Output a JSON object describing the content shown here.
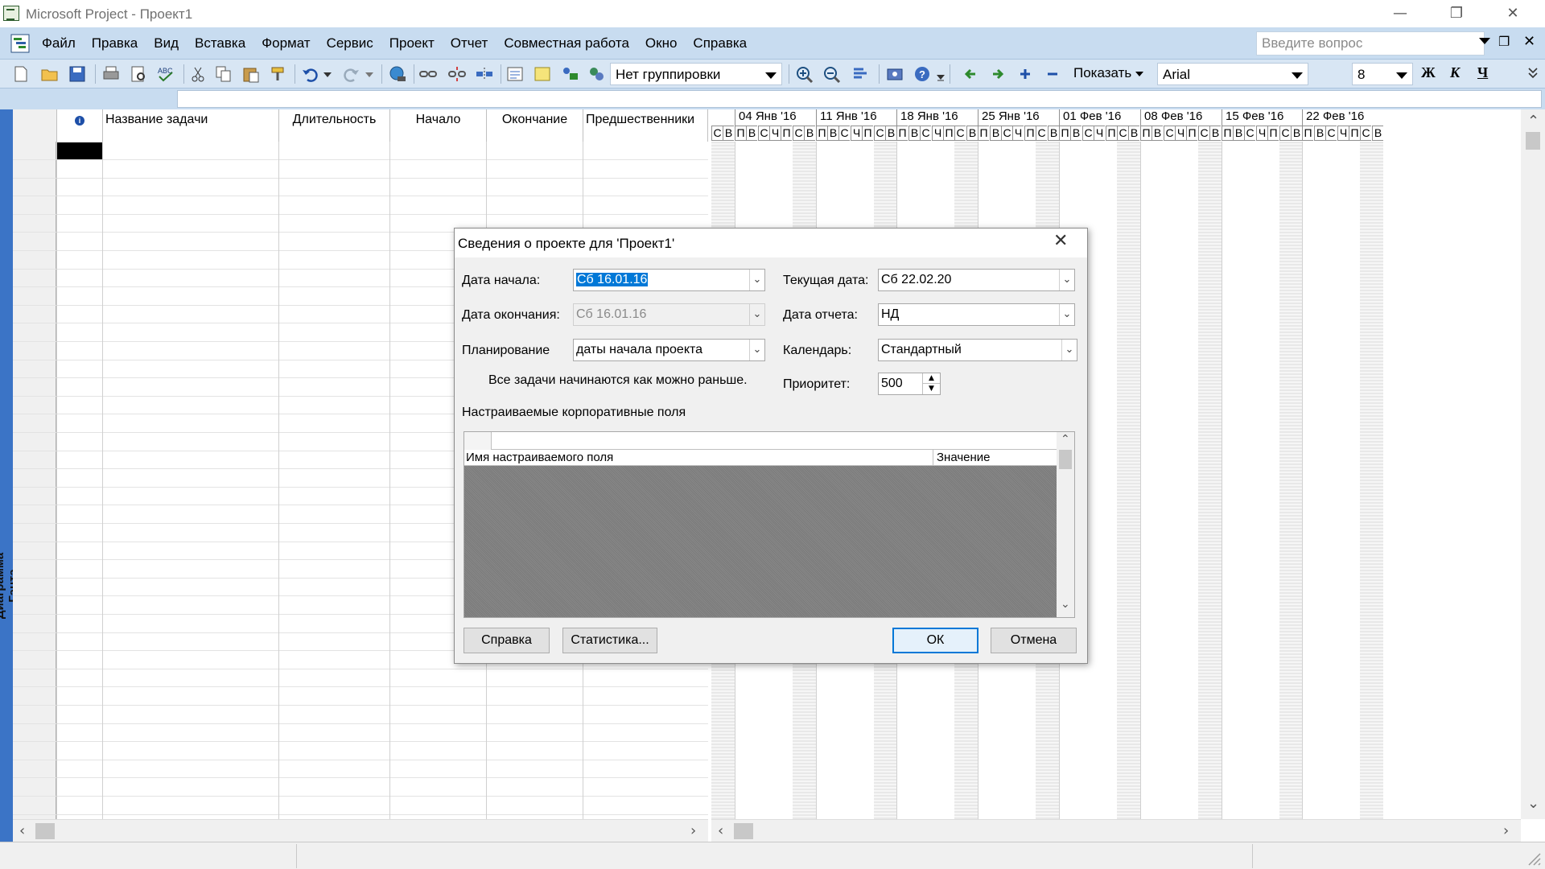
{
  "window": {
    "title": "Microsoft Project - Проект1"
  },
  "menu": {
    "items": [
      "Файл",
      "Правка",
      "Вид",
      "Вставка",
      "Формат",
      "Сервис",
      "Проект",
      "Отчет",
      "Совместная работа",
      "Окно",
      "Справка"
    ],
    "help_placeholder": "Введите вопрос"
  },
  "toolbar": {
    "grouping": "Нет группировки",
    "show_label": "Показать",
    "font": "Arial",
    "font_size": "8",
    "bold": "Ж",
    "italic": "К",
    "underline": "Ч"
  },
  "viewbar": {
    "label": "Диаграмма Ганта"
  },
  "table": {
    "info_icon": "i",
    "columns": [
      "Название задачи",
      "Длительность",
      "Начало",
      "Окончание",
      "Предшественники"
    ]
  },
  "gantt": {
    "weeks": [
      "04 Янв '16",
      "11 Янв '16",
      "18 Янв '16",
      "25 Янв '16",
      "01 Фев '16",
      "08 Фев '16",
      "15 Фев '16",
      "22 Фев '16"
    ],
    "days": [
      "П",
      "В",
      "С",
      "Ч",
      "П",
      "С",
      "В"
    ],
    "first_days": [
      "С",
      "В"
    ]
  },
  "dialog": {
    "title": "Сведения о проекте для 'Проект1'",
    "start_date_label": "Дата начала:",
    "start_date_value": "Сб 16.01.16",
    "finish_date_label": "Дата окончания:",
    "finish_date_value": "Сб 16.01.16",
    "schedule_label": "Планирование",
    "schedule_value": "даты начала проекта",
    "schedule_note": "Все задачи начинаются как можно раньше.",
    "current_date_label": "Текущая дата:",
    "current_date_value": "Сб 22.02.20",
    "status_date_label": "Дата отчета:",
    "status_date_value": "НД",
    "calendar_label": "Календарь:",
    "calendar_value": "Стандартный",
    "priority_label": "Приоритет:",
    "priority_value": "500",
    "custom_fields_label": "Настраиваемые корпоративные поля",
    "custom_field_name_header": "Имя настраиваемого поля",
    "custom_field_value_header": "Значение",
    "help_button": "Справка",
    "statistics_button": "Статистика...",
    "ok_button": "ОК",
    "cancel_button": "Отмена"
  }
}
